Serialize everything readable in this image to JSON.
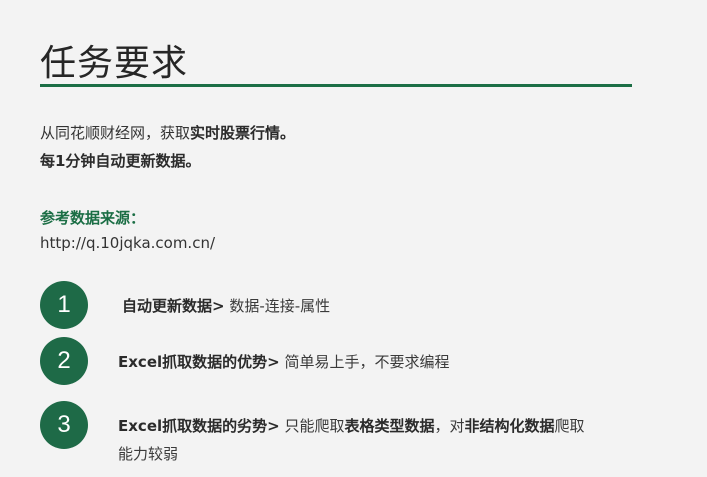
{
  "title": "任务要求",
  "intro": {
    "line1_prefix": "从同花顺财经网，获取",
    "line1_bold": "实时股票行情。",
    "line2_bold": "每1分钟自动更新数据。"
  },
  "reference": {
    "label": "参考数据来源：",
    "url": "http://q.10jqka.com.cn/"
  },
  "steps": [
    {
      "number": "1",
      "bold": "自动更新数据>",
      "rest": " 数据-连接-属性"
    },
    {
      "number": "2",
      "bold": "Excel抓取数据的优势>",
      "rest": " 简单易上手，不要求编程"
    },
    {
      "number": "3",
      "bold": "Excel抓取数据的劣势>",
      "rest_a": " 只能爬取",
      "bold_b": "表格类型数据",
      "rest_c": "，对",
      "bold_d": "非结构化数据",
      "rest_e": "爬取",
      "line2": "能力较弱"
    }
  ],
  "colors": {
    "accent": "#1b6e45",
    "circle": "#1e6a47",
    "background": "#f3f3f3"
  }
}
